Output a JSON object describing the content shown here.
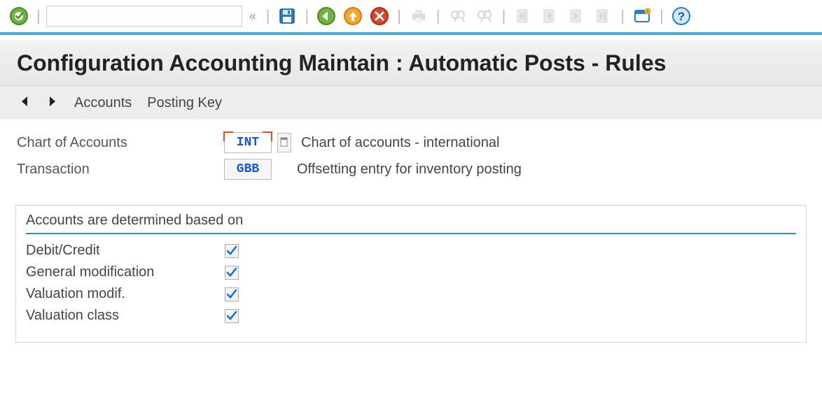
{
  "toolbar": {
    "command_value": "",
    "command_placeholder": ""
  },
  "title": "Configuration Accounting Maintain : Automatic Posts - Rules",
  "subtoolbar": {
    "accounts_label": "Accounts",
    "posting_key_label": "Posting Key"
  },
  "form": {
    "chart_of_accounts": {
      "label": "Chart of Accounts",
      "code": "INT",
      "description": "Chart of accounts - international"
    },
    "transaction": {
      "label": "Transaction",
      "code": "GBB",
      "description": "Offsetting entry for inventory posting"
    }
  },
  "section": {
    "title": "Accounts are determined based on",
    "rows": [
      {
        "label": "Debit/Credit",
        "checked": true
      },
      {
        "label": "General modification",
        "checked": true
      },
      {
        "label": "Valuation modif.",
        "checked": true
      },
      {
        "label": "Valuation class",
        "checked": true
      }
    ]
  }
}
